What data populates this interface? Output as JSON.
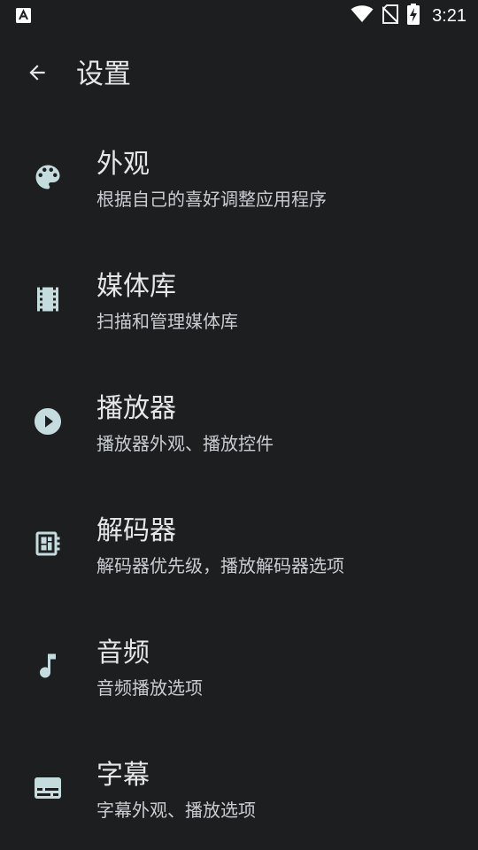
{
  "status_bar": {
    "time": "3:21",
    "left_icon": "accessibility-notification-icon",
    "right_icons": [
      "wifi-icon",
      "no-sim-icon",
      "battery-charging-icon"
    ]
  },
  "app_bar": {
    "back_icon": "arrow-back-icon",
    "title": "设置"
  },
  "settings": {
    "items": [
      {
        "title": "外观",
        "summary": "根据自己的喜好调整应用程序",
        "icon": "palette-icon"
      },
      {
        "title": "媒体库",
        "summary": "扫描和管理媒体库",
        "icon": "film-strip-icon"
      },
      {
        "title": "播放器",
        "summary": "播放器外观、播放控件",
        "icon": "play-circle-icon"
      },
      {
        "title": "解码器",
        "summary": "解码器优先级，播放解码器选项",
        "icon": "decoder-chip-icon"
      },
      {
        "title": "音频",
        "summary": "音频播放选项",
        "icon": "music-note-icon"
      },
      {
        "title": "字幕",
        "summary": "字幕外观、播放选项",
        "icon": "subtitles-icon"
      }
    ]
  },
  "colors": {
    "background": "#1c1e20",
    "icon": "#c4dcde",
    "text_primary": "#e6e6e6",
    "text_secondary": "#c9cdd1"
  }
}
